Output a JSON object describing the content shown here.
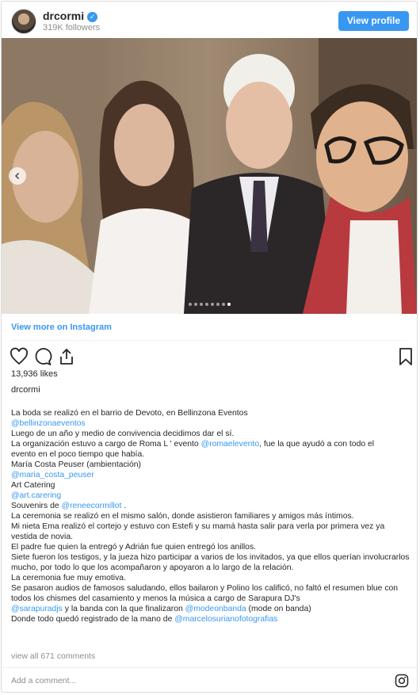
{
  "header": {
    "username": "drcormi",
    "followers": "319K followers",
    "view_profile_label": "View profile"
  },
  "carousel": {
    "slide_count": 8,
    "active_index": 7
  },
  "view_more_label": "View more on Instagram",
  "likes": "13,936 likes",
  "owner_name": "drcormi",
  "caption": {
    "line1": "La boda se realizó en el barrio de Devoto, en Bellinzona Eventos",
    "m1": "@bellinzonaeventos",
    "line2": "Luego de un año y medio de convivencia decidimos dar el sí.",
    "line3a": "La organización estuvo a cargo de Roma L ' evento ",
    "m2": "@romaelevento",
    "line3b": ", fue la que ayudó a con todo el",
    "line4": "evento en el poco tiempo que había.",
    "line5": "María Costa Peuser (ambientación)",
    "m3": "@maria_costa_peuser",
    "line6": "Art Catering",
    "m4": "@art.carering",
    "line7a": "Souvenirs de ",
    "m5": "@reneecormillot",
    "line7b": " .",
    "line8": "La ceremonia se realizó en el mismo salón, donde asistieron familiares y amigos más íntimos.",
    "line9": "Mi nieta Ema realizó el cortejo y estuvo con Estefi y su mamá hasta salir para verla por primera vez ya vestida de novia.",
    "line10": "El padre fue quien la entregó y Adrián fue quien entregó los anillos.",
    "line11": "Siete fueron los testigos, y la jueza hizo participar a varios de los invitados, ya que ellos querían involucrarlos mucho, por todo lo que los acompañaron y apoyaron a lo largo de la relación.",
    "line12": "La ceremonia fue muy emotiva.",
    "line13": "Se pasaron audios de famosos saludando, ellos bailaron y Polino los calificó, no faltó el resumen blue con todos los chismes del casamiento y menos la música a cargo de Sarapura DJ's",
    "m6": "@sarapuradjs",
    "line14a": " y la banda con la que finalizaron ",
    "m7": "@modeonbanda",
    "line14b": " (mode on banda)",
    "line15a": "Donde todo quedó registrado de la mano de ",
    "m8": "@marcelosurianofotografias"
  },
  "comments_link": "view all 671 comments",
  "comment_placeholder": "Add a comment...",
  "colors": {
    "accent": "#3897f0",
    "text": "#262626",
    "muted": "#8e8e8e",
    "border": "#dbdbdb"
  },
  "icons": {
    "verified": "verified-badge-icon",
    "like": "heart-icon",
    "comment": "comment-icon",
    "share": "share-icon",
    "save": "bookmark-icon",
    "prev": "chevron-left-icon",
    "logo": "instagram-logo-icon"
  }
}
